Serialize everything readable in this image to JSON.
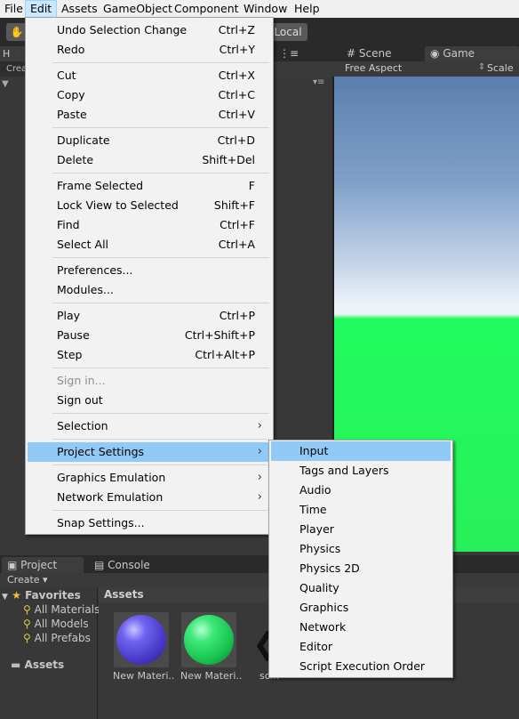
{
  "menubar": {
    "items": [
      "File",
      "Edit",
      "Assets",
      "GameObject",
      "Component",
      "Window",
      "Help"
    ],
    "active": "Edit"
  },
  "toolbar": {
    "hand_icon": "hand-icon",
    "pivot_local_label": "Local"
  },
  "hierarchy": {
    "tab_label": "H",
    "create_label": "Crea"
  },
  "scene": {
    "tab_scene": "Scene",
    "tab_game": "Game",
    "aspect_label": "Free Aspect",
    "scale_label": "Scale"
  },
  "edit_menu": {
    "groups": [
      [
        {
          "label": "Undo Selection Change",
          "shortcut": "Ctrl+Z"
        },
        {
          "label": "Redo",
          "shortcut": "Ctrl+Y"
        }
      ],
      [
        {
          "label": "Cut",
          "shortcut": "Ctrl+X"
        },
        {
          "label": "Copy",
          "shortcut": "Ctrl+C"
        },
        {
          "label": "Paste",
          "shortcut": "Ctrl+V"
        }
      ],
      [
        {
          "label": "Duplicate",
          "shortcut": "Ctrl+D"
        },
        {
          "label": "Delete",
          "shortcut": "Shift+Del"
        }
      ],
      [
        {
          "label": "Frame Selected",
          "shortcut": "F"
        },
        {
          "label": "Lock View to Selected",
          "shortcut": "Shift+F"
        },
        {
          "label": "Find",
          "shortcut": "Ctrl+F"
        },
        {
          "label": "Select All",
          "shortcut": "Ctrl+A"
        }
      ],
      [
        {
          "label": "Preferences...",
          "shortcut": ""
        },
        {
          "label": "Modules...",
          "shortcut": ""
        }
      ],
      [
        {
          "label": "Play",
          "shortcut": "Ctrl+P"
        },
        {
          "label": "Pause",
          "shortcut": "Ctrl+Shift+P"
        },
        {
          "label": "Step",
          "shortcut": "Ctrl+Alt+P"
        }
      ],
      [
        {
          "label": "Sign in...",
          "shortcut": "",
          "disabled": true
        },
        {
          "label": "Sign out",
          "shortcut": ""
        }
      ],
      [
        {
          "label": "Selection",
          "shortcut": "",
          "submenu": true
        }
      ],
      [
        {
          "label": "Project Settings",
          "shortcut": "",
          "submenu": true,
          "highlight": true
        }
      ],
      [
        {
          "label": "Graphics Emulation",
          "shortcut": "",
          "submenu": true
        },
        {
          "label": "Network Emulation",
          "shortcut": "",
          "submenu": true
        }
      ],
      [
        {
          "label": "Snap Settings...",
          "shortcut": ""
        }
      ]
    ]
  },
  "project_settings_menu": {
    "items": [
      "Input",
      "Tags and Layers",
      "Audio",
      "Time",
      "Player",
      "Physics",
      "Physics 2D",
      "Quality",
      "Graphics",
      "Network",
      "Editor",
      "Script Execution Order"
    ],
    "highlighted": "Input"
  },
  "project": {
    "tab_project": "Project",
    "tab_console": "Console",
    "create_label": "Create",
    "favorites_label": "Favorites",
    "favorites": [
      "All Materials",
      "All Models",
      "All Prefabs"
    ],
    "assets_folder": "Assets",
    "assets_header": "Assets",
    "asset_items": [
      {
        "name": "New Materi...",
        "color": "#5a4fd8"
      },
      {
        "name": "New Materi...",
        "color": "#22c95a"
      },
      {
        "name": "sc...",
        "color": "#222222"
      }
    ]
  },
  "colors": {
    "menu_highlight": "#91c9f7",
    "sky_top": "#5b7fae",
    "ground": "#28f05a"
  }
}
